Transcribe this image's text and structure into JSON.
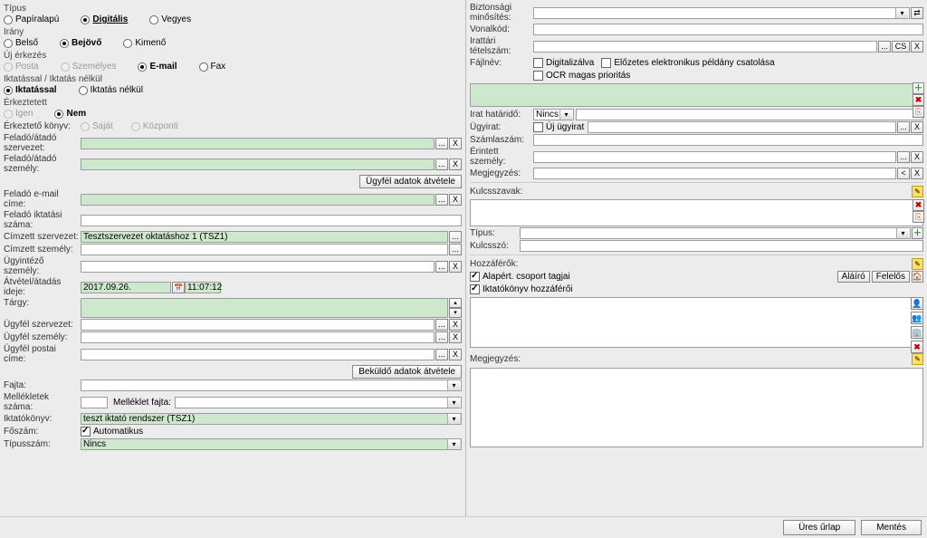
{
  "left": {
    "tipus": {
      "title": "Típus",
      "papir": "Papíralapú",
      "digitalis": "Digitális",
      "vegyes": "Vegyes"
    },
    "irany": {
      "title": "Irány",
      "belso": "Belső",
      "bejovo": "Bejövő",
      "kimeno": "Kimenő"
    },
    "ujerkezes": {
      "title": "Új érkezés",
      "posta": "Posta",
      "szemelyes": "Személyes",
      "email": "E-mail",
      "fax": "Fax"
    },
    "iktnelkul": {
      "title": "Iktatással / Iktatás nélkül",
      "iktassal": "Iktatással",
      "iktnelkul": "Iktatás nélkül"
    },
    "erkeztetett": {
      "title": "Érkeztetett",
      "igen": "Igen",
      "nem": "Nem"
    },
    "erkeztetokonyv": {
      "label": "Érkeztető könyv:",
      "sajat": "Saját",
      "kozponti": "Központi"
    },
    "felado_szervezet": "Feladó/átadó szervezet:",
    "felado_szemely": "Feladó/átadó személy:",
    "ugyfel_adatok_atvetele": "Ügyfél adatok átvétele",
    "felado_email": "Feladó e-mail címe:",
    "felado_iktatasi": "Feladó iktatási száma:",
    "cimzett_szervezet": "Címzett szervezet:",
    "cimzett_szervezet_val": "Tesztszervezet oktatáshoz 1 (TSZ1)",
    "cimzett_szemely": "Címzett személy:",
    "ugyintezo_szemely": "Ügyintéző személy:",
    "atvetel_ideje": "Átvétel/átadás ideje:",
    "atvetel_date": "2017.09.26.",
    "atvetel_time": "11:07:12",
    "targy": "Tárgy:",
    "ugyfel_szervezet": "Ügyfél szervezet:",
    "ugyfel_szemely": "Ügyfél személy:",
    "ugyfel_postai": "Ügyfél postai címe:",
    "bekuldo_btn": "Beküldő adatok átvétele",
    "fajta": "Fajta:",
    "mellekletek_szama": "Mellékletek száma:",
    "melleklet_fajta": "Melléklet fajta:",
    "iktatokonyv": "Iktatókönyv:",
    "iktatokonyv_val": "teszt iktató rendszer (TSZ1)",
    "foszam": "Főszám:",
    "automatikus": "Automatikus",
    "tipusszam": "Típusszám:",
    "tipusszam_val": "Nincs"
  },
  "right": {
    "biztonsagi": "Biztonsági minősítés:",
    "vonalkod": "Vonalkód:",
    "irattari": "Irattári tételszám:",
    "fajlnev": "Fájlnév:",
    "digitalizalva": "Digitalizálva",
    "elozetes": "Előzetes elektronikus példány csatolása",
    "ocr": "OCR magas prioritás",
    "irat_hatarido": "Irat határidő:",
    "irat_hatarido_val": "Nincs",
    "ugyirat": "Ügyirat:",
    "uj_ugyirat": "Új ügyirat",
    "szamlaszam": "Számlaszám:",
    "erintett": "Érintett személy:",
    "megjegyzes": "Megjegyzés:",
    "kulcsszavak": "Kulcsszavak:",
    "tipus": "Típus:",
    "kulcsszo": "Kulcsszó:",
    "hozzaferok": "Hozzáférők:",
    "alapert": "Alapért. csoport tagjai",
    "iktatokonyv_hozza": "Iktatókönyv hozzáférői",
    "alairo": "Aláíró",
    "felelos": "Felelős",
    "megjegyzes2": "Megjegyzés:",
    "cs": "CS",
    "x": "X",
    "dots": "...",
    "lt": "<"
  },
  "footer": {
    "ures_urlap": "Üres űrlap",
    "mentes": "Mentés"
  }
}
